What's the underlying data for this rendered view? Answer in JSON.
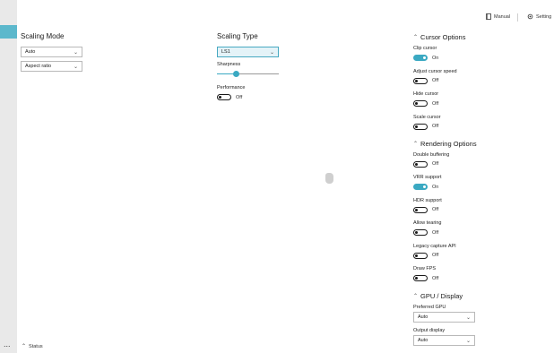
{
  "topbar": {
    "manual_label": "Manual",
    "settings_label": "Setting"
  },
  "scaling_mode": {
    "title": "Scaling Mode",
    "mode_value": "Auto",
    "aspect_value": "Aspect ratio"
  },
  "scaling_type": {
    "title": "Scaling Type",
    "type_value": "LS1",
    "sharpness_label": "Sharpness",
    "sharpness_level": 0.3,
    "performance_label": "Performance",
    "performance_state": "Off"
  },
  "cursor_options": {
    "title": "Cursor Options",
    "items": [
      {
        "label": "Clip cursor",
        "state": "On"
      },
      {
        "label": "Adjust cursor speed",
        "state": "Off"
      },
      {
        "label": "Hide cursor",
        "state": "Off"
      },
      {
        "label": "Scale cursor",
        "state": "Off"
      }
    ]
  },
  "rendering_options": {
    "title": "Rendering Options",
    "items": [
      {
        "label": "Double buffering",
        "state": "Off"
      },
      {
        "label": "VRR support",
        "state": "On"
      },
      {
        "label": "HDR support",
        "state": "Off"
      },
      {
        "label": "Allow tearing",
        "state": "Off"
      },
      {
        "label": "Legacy capture API",
        "state": "Off"
      },
      {
        "label": "Draw FPS",
        "state": "Off"
      }
    ]
  },
  "gpu_display": {
    "title": "GPU / Display",
    "preferred_gpu_label": "Preferred GPU",
    "preferred_gpu_value": "Auto",
    "output_display_label": "Output display",
    "output_display_value": "Auto"
  },
  "status_bar": {
    "label": "Status",
    "more_glyph": "..."
  },
  "colors": {
    "accent": "#3aa9c2",
    "nav_background": "#e9e9e9"
  },
  "icons": [
    "book-icon",
    "gear-icon",
    "chevron-down-icon",
    "chevron-up-icon",
    "more-icon"
  ]
}
